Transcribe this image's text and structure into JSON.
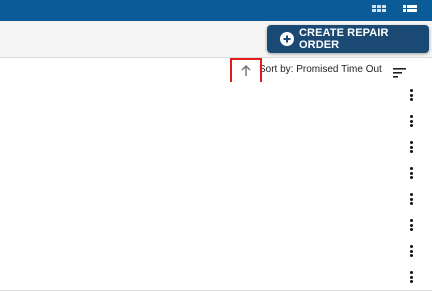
{
  "header": {
    "view_icons": [
      "grid-view-icon",
      "list-view-icon"
    ],
    "background": "#0a5b98"
  },
  "toolbar": {
    "create_button_label": "CREATE REPAIR ORDER",
    "create_button_icon": "plus-circle-icon",
    "create_button_color": "#1a4a74"
  },
  "sort": {
    "prefix": "Sort by: ",
    "field": "Promised Time Out",
    "direction_icon": "arrow-up-icon",
    "options_icon": "sort-lines-icon"
  },
  "rows": [
    {
      "menu_icon": "more-vert-icon"
    },
    {
      "menu_icon": "more-vert-icon"
    },
    {
      "menu_icon": "more-vert-icon"
    },
    {
      "menu_icon": "more-vert-icon"
    },
    {
      "menu_icon": "more-vert-icon"
    },
    {
      "menu_icon": "more-vert-icon"
    },
    {
      "menu_icon": "more-vert-icon"
    },
    {
      "menu_icon": "more-vert-icon"
    }
  ],
  "annotation": {
    "highlight_color": "#e21b1b"
  }
}
